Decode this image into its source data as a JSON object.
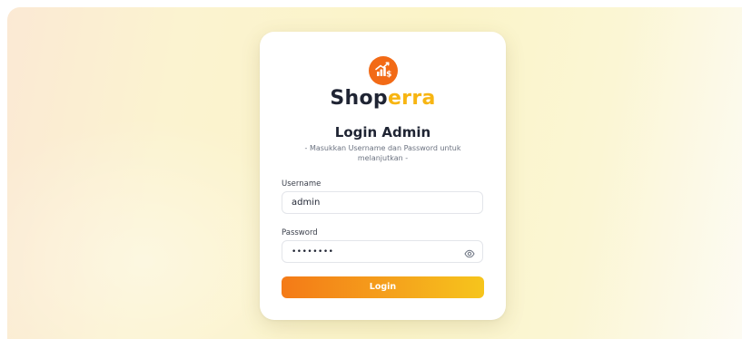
{
  "brand": {
    "name_part1": "Shop",
    "name_part2": "erra",
    "logo_icon": "chart-dollar-icon",
    "colors": {
      "primary_dark": "#1f2433",
      "accent_yellow": "#f7b512",
      "logo_orange": "#f26a16"
    }
  },
  "login": {
    "title": "Login Admin",
    "subtitle": "- Masukkan Username dan Password untuk melanjutkan -",
    "username_label": "Username",
    "username_value": "admin",
    "password_label": "Password",
    "password_value": "••••••••",
    "password_toggle_icon": "eye-icon",
    "button_label": "Login",
    "button_gradient": [
      "#f47a17",
      "#f6c51c"
    ]
  }
}
